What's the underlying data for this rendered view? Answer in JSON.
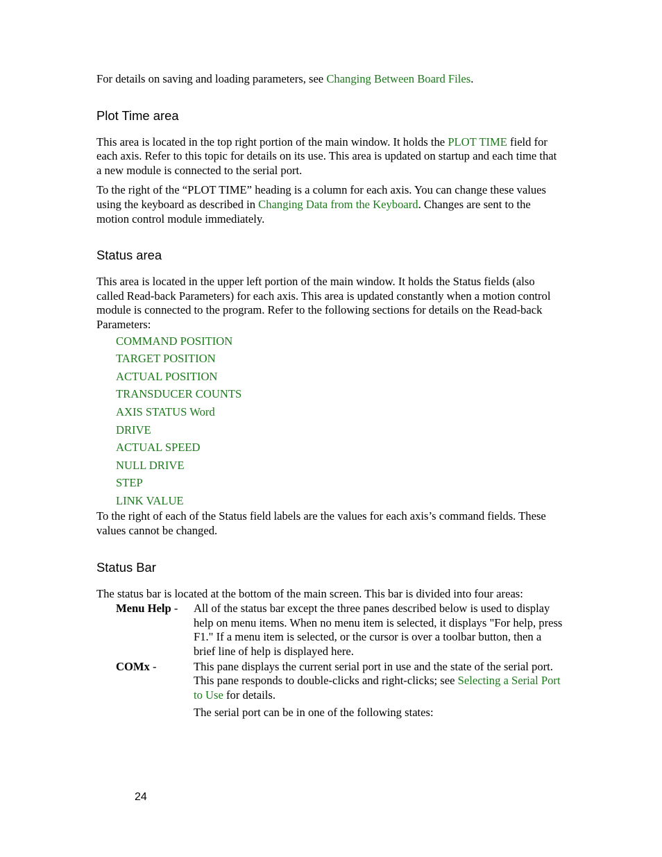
{
  "document": {
    "page_number": "24"
  },
  "intro": {
    "text_before": "For details on saving and loading parameters, see ",
    "link": "Changing Between Board Files",
    "text_after": "."
  },
  "plot_time_section": {
    "heading": "Plot Time area",
    "paragraph1_part1": "This area is located in the top right portion of the main window.  It holds the ",
    "paragraph1_link": "PLOT TIME",
    "paragraph1_part2": " field for each axis.  Refer to this topic for details on its use.  This area is updated on startup and each time that a new module is connected to the serial port.",
    "paragraph2_part1": "To the right of the “PLOT TIME” heading is a column for each axis.  You can change these values using the keyboard as described in ",
    "paragraph2_link": "Changing Data from the Keyboard",
    "paragraph2_part2": ".  Changes are sent to the motion control module immediately."
  },
  "status_area_section": {
    "heading": "Status area",
    "paragraph1": "This area is located in the upper left portion of the main window.  It holds the Status fields (also called Read-back Parameters) for each axis.  This area is updated constantly when a motion control module is connected to the program.  Refer to the following sections for details on the Read-back Parameters:",
    "parameter_links": [
      "COMMAND POSITION",
      "TARGET POSITION",
      "ACTUAL POSITION",
      "TRANSDUCER COUNTS",
      "AXIS STATUS Word",
      "DRIVE",
      "ACTUAL SPEED",
      "NULL DRIVE",
      "STEP",
      "LINK VALUE"
    ],
    "paragraph2": "To the right of each of the Status field labels are the values for each axis’s command fields.  These values cannot be changed."
  },
  "status_bar_section": {
    "heading": "Status Bar",
    "paragraph1": "The status bar is located at the bottom of the main screen.  This bar is divided into four areas:",
    "entries": [
      {
        "term": "Menu Help",
        "dash": " - ",
        "description": "All of the status bar except the three panes described below is used to display help on menu items.  When no menu item is selected, it displays \"For help, press F1.\"  If a menu item is selected, or the cursor is over a toolbar button, then a brief line of help is displayed here."
      },
      {
        "term": "COMx",
        "dash": " - ",
        "description_part1": "This pane displays the current serial port in use and the state of the serial port.  This pane responds to double-clicks and right-clicks; see ",
        "description_link": "Selecting a Serial Port to Use",
        "description_part2": " for details.",
        "description_line2": "The serial port can be in one of the following states:"
      }
    ]
  },
  "colors": {
    "link_green": "#1c7a1c",
    "body_black": "#000000",
    "page_background": "#ffffff"
  }
}
